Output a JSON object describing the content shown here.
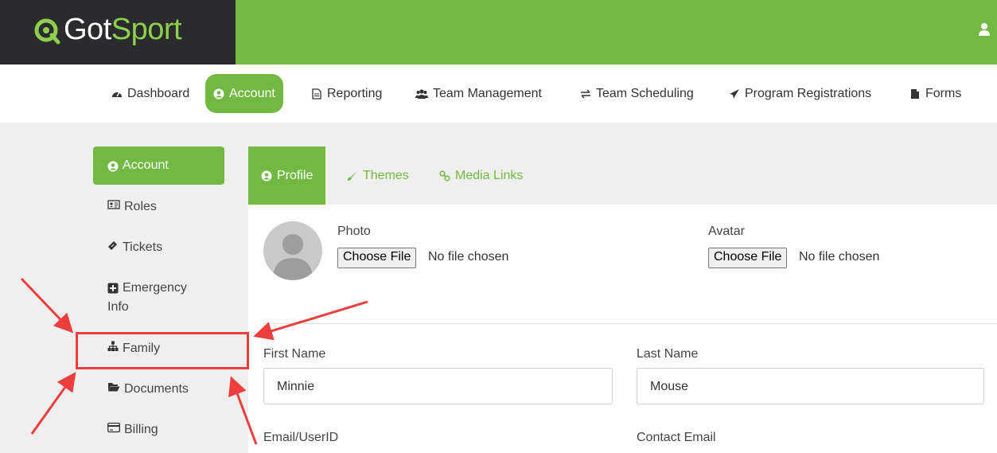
{
  "logo": {
    "part1": "Got",
    "part2": "Sport"
  },
  "nav": [
    {
      "label": "Dashboard",
      "icon": "dashboard-icon"
    },
    {
      "label": "Account",
      "icon": "user-circle-icon"
    },
    {
      "label": "Reporting",
      "icon": "file-text-icon"
    },
    {
      "label": "Team Management",
      "icon": "users-icon"
    },
    {
      "label": "Team Scheduling",
      "icon": "exchange-icon"
    },
    {
      "label": "Program Registrations",
      "icon": "paper-plane-icon"
    },
    {
      "label": "Forms",
      "icon": "file-icon"
    }
  ],
  "sidebar": [
    {
      "label": "Account",
      "icon": "user-circle-icon"
    },
    {
      "label": "Roles",
      "icon": "id-card-icon"
    },
    {
      "label": "Tickets",
      "icon": "ticket-icon"
    },
    {
      "label": "Emergency",
      "label2": "Info",
      "icon": "plus-square-icon"
    },
    {
      "label": "Family",
      "icon": "sitemap-icon"
    },
    {
      "label": "Documents",
      "icon": "folder-open-icon"
    },
    {
      "label": "Billing",
      "icon": "credit-card-icon"
    }
  ],
  "tabs": [
    {
      "label": "Profile",
      "icon": "user-circle-icon"
    },
    {
      "label": "Themes",
      "icon": "paint-brush-icon"
    },
    {
      "label": "Media Links",
      "icon": "link-icon"
    }
  ],
  "profile": {
    "photo_label": "Photo",
    "avatar_label": "Avatar",
    "choose_file": "Choose File",
    "no_file": "No file chosen",
    "first_name_label": "First Name",
    "first_name_value": "Minnie",
    "last_name_label": "Last Name",
    "last_name_value": "Mouse",
    "email_label": "Email/UserID",
    "contact_email_label": "Contact Email"
  },
  "colors": {
    "brand_green": "#72b944",
    "dark": "#2b2b2d",
    "annotation_red": "#ee3d3d"
  }
}
